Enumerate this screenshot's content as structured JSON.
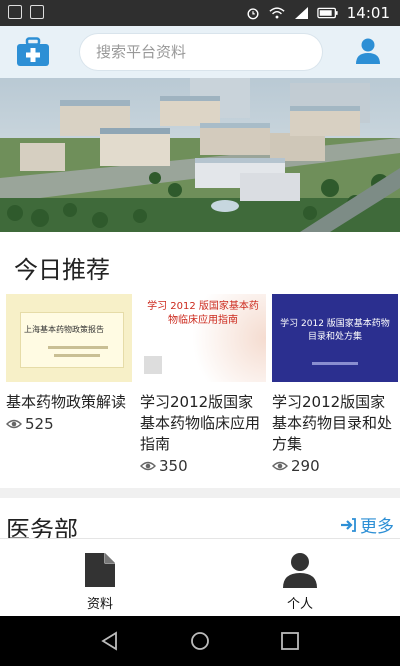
{
  "status_bar": {
    "time": "14:01"
  },
  "header": {
    "search_placeholder": "搜索平台资料",
    "kit_icon": "medical-kit-icon",
    "user_icon": "user-icon"
  },
  "today": {
    "title": "今日推荐",
    "cards": [
      {
        "title": "基本药物政策解读",
        "views": "525",
        "thumb_text": "上海基本药物政策报告"
      },
      {
        "title": "学习2012版国家基本药物临床应用指南",
        "views": "350",
        "thumb_text": "学习 2012 版国家基本药物临床应用指南"
      },
      {
        "title": "学习2012版国家基本药物目录和处方集",
        "views": "290",
        "thumb_text": "学习 2012 版国家基本药物目录和处方集"
      }
    ]
  },
  "section2": {
    "title": "医务部",
    "more": "更多"
  },
  "tabbar": {
    "tabs": [
      {
        "label": "资料",
        "icon": "document-icon"
      },
      {
        "label": "个人",
        "icon": "person-icon"
      }
    ]
  },
  "colors": {
    "accent": "#2d8fd5",
    "header_bg": "#e8f1f7"
  }
}
